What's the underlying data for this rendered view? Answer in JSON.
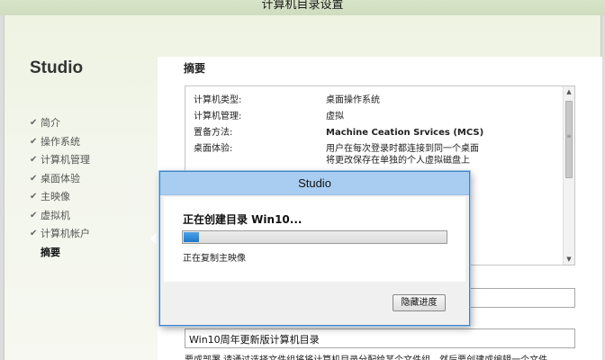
{
  "window": {
    "title": "计算机目录设置"
  },
  "brand": "Studio",
  "nav": {
    "items": [
      {
        "label": "简介",
        "done": true
      },
      {
        "label": "操作系统",
        "done": true
      },
      {
        "label": "计算机管理",
        "done": true
      },
      {
        "label": "桌面体验",
        "done": true
      },
      {
        "label": "主映像",
        "done": true
      },
      {
        "label": "虚拟机",
        "done": true
      },
      {
        "label": "计算机帐户",
        "done": true
      },
      {
        "label": "摘要",
        "done": false,
        "current": true
      }
    ],
    "check_glyph": "✔"
  },
  "main": {
    "title": "摘要",
    "summary": [
      {
        "key": "计算机类型:",
        "value": "桌面操作系统",
        "bold": false
      },
      {
        "key": "计算机管理:",
        "value": "虚拟",
        "bold": false
      },
      {
        "key": "置备方法:",
        "value": "Machine Ceation Srvices (MCS)",
        "bold": true
      },
      {
        "key": "桌面体验:",
        "value": "用户在每次登录时都连接到同一个桌面\n将更改保存在单独的个人虚拟磁盘上",
        "bold": false
      }
    ],
    "catalog_name_value": "Win10周年更新版计算机目录",
    "description_text": "要或部署   请通过选择文件组将将计算机目录分配给某个文件组，然后要创建或编辑一个文件"
  },
  "dialog": {
    "title": "Studio",
    "heading": "正在创建目录 Win10...",
    "progress_fraction": 0.06,
    "status": "正在复制主映像",
    "hide_button": "隐藏进度"
  },
  "colors": {
    "dialog_border": "#3e82c4",
    "dialog_titlebar": "#a9cdf0",
    "progress_fill": "#1f78c9",
    "wizard_background": "#eef3e2"
  }
}
